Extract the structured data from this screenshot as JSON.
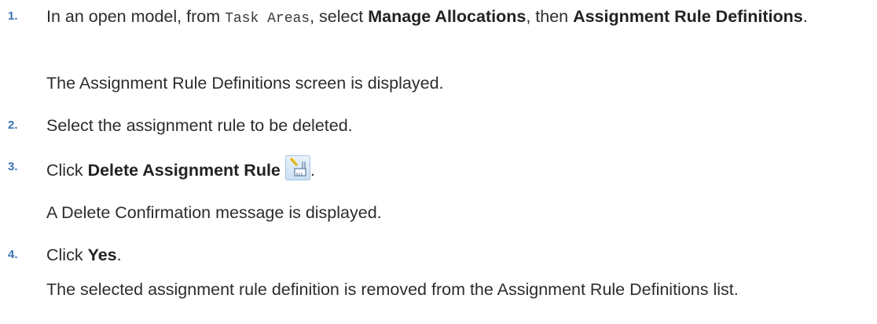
{
  "steps": [
    {
      "number": "1.",
      "prefix": "In an open model, from ",
      "code": "Task Areas",
      "mid1": ", select ",
      "bold1": "Manage Allocations",
      "mid2": ", then ",
      "bold2": "Assignment Rule Definitions",
      "suffix": ".",
      "result": "The Assignment Rule Definitions screen is displayed."
    },
    {
      "number": "2.",
      "text": "Select the assignment rule to be deleted."
    },
    {
      "number": "3.",
      "prefix": "Click ",
      "bold": "Delete Assignment Rule",
      "icon": "delete-assignment-rule-icon",
      "suffix": ".",
      "result": "A Delete Confirmation message is displayed."
    },
    {
      "number": "4.",
      "prefix": "Click ",
      "bold": "Yes",
      "suffix": ".",
      "result": "The selected assignment rule definition is removed from the Assignment Rule Definitions list."
    }
  ],
  "colors": {
    "step_number": "#3a73b0",
    "text": "#2c2c2c"
  }
}
